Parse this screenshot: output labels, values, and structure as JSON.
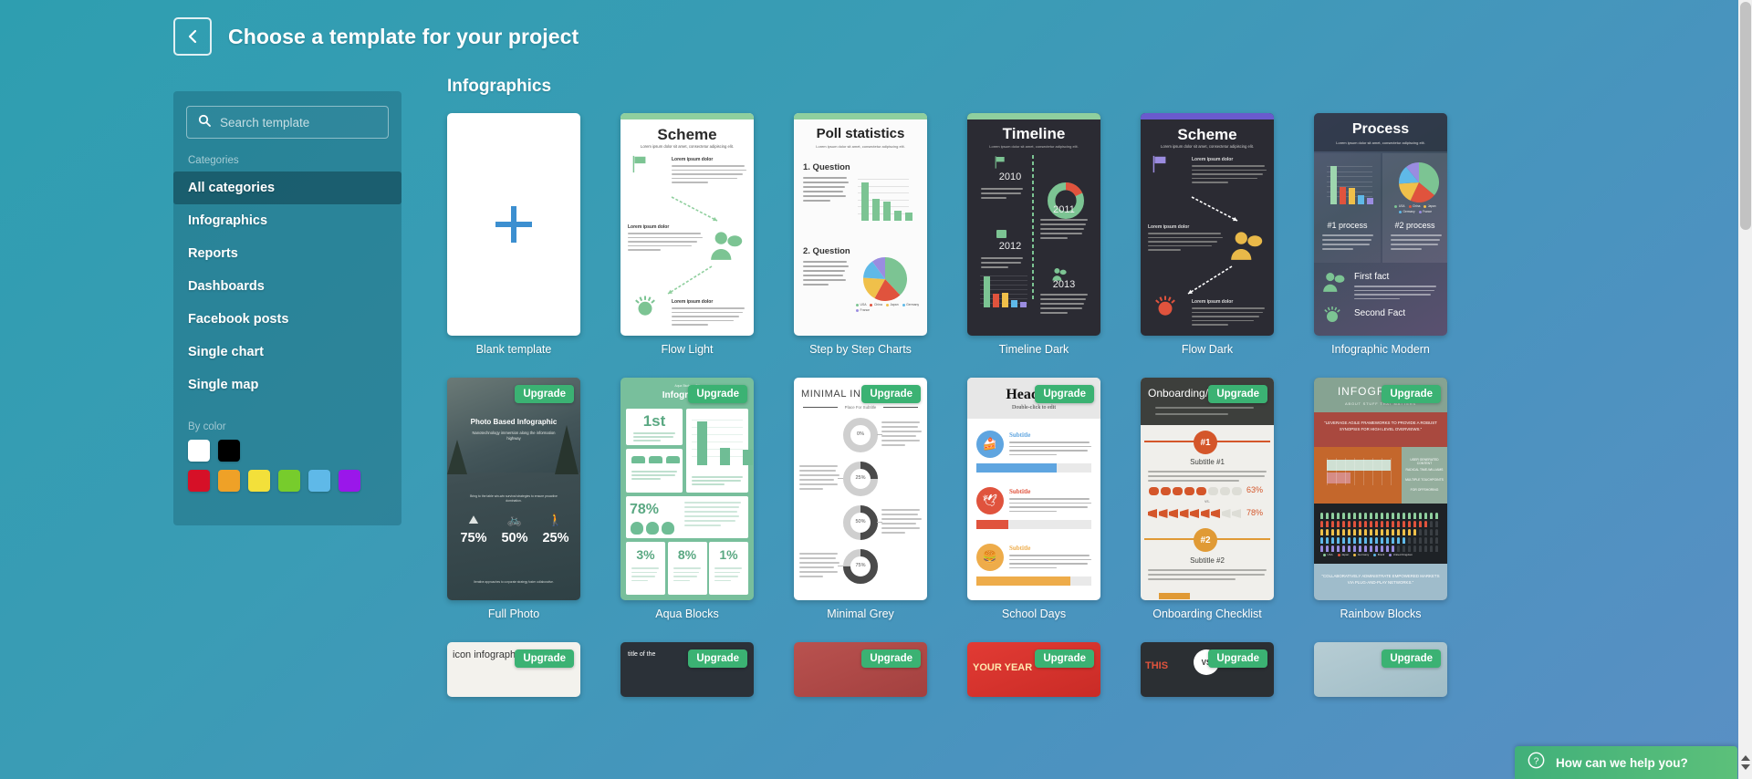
{
  "header": {
    "title": "Choose a template for your project",
    "back_icon": "chevron-left-icon"
  },
  "sidebar": {
    "search": {
      "placeholder": "Search template",
      "value": "",
      "icon": "search-icon"
    },
    "categories_heading": "Categories",
    "categories": [
      {
        "label": "All categories",
        "active": true
      },
      {
        "label": "Infographics",
        "active": false
      },
      {
        "label": "Reports",
        "active": false
      },
      {
        "label": "Dashboards",
        "active": false
      },
      {
        "label": "Facebook posts",
        "active": false
      },
      {
        "label": "Single chart",
        "active": false
      },
      {
        "label": "Single map",
        "active": false
      }
    ],
    "bycolor_heading": "By color",
    "colors": [
      [
        "#ffffff",
        "#000000"
      ],
      [
        "#d61027",
        "#efa127",
        "#f3e03a",
        "#77cc2c",
        "#5fb9e8",
        "#9a17ea"
      ]
    ]
  },
  "main": {
    "section_title": "Infographics",
    "rows": [
      {
        "cards": [
          {
            "label": "Blank template",
            "upgrade": false,
            "kind": "blank"
          },
          {
            "label": "Flow Light",
            "upgrade": false,
            "kind": "flow-light",
            "title": "Scheme",
            "subtitle": "Lorem ipsum dolor sit amet, consectetur adipiscing elit.",
            "blocks": [
              "Lorem ipsum dolor",
              "Lorem ipsum dolor",
              "Lorem ipsum dolor"
            ]
          },
          {
            "label": "Step by Step Charts",
            "upgrade": false,
            "kind": "poll",
            "title": "Poll statistics",
            "subtitle": "Lorem ipsum dolor sit amet, consectetur adipiscing elit.",
            "q1": "1. Question",
            "q2": "2. Question"
          },
          {
            "label": "Timeline Dark",
            "upgrade": false,
            "kind": "timeline-dark",
            "title": "Timeline",
            "subtitle": "Lorem ipsum dolor sit amet, consectetur adipiscing elit.",
            "years": [
              "2010",
              "2011",
              "2012",
              "2013"
            ]
          },
          {
            "label": "Flow Dark",
            "upgrade": false,
            "kind": "flow-dark",
            "title": "Scheme",
            "subtitle": "Lorem ipsum dolor sit amet, consectetur adipiscing elit.",
            "blocks": [
              "Lorem ipsum dolor",
              "Lorem ipsum dolor",
              "Lorem ipsum dolor"
            ]
          },
          {
            "label": "Infographic Modern",
            "upgrade": false,
            "kind": "modern",
            "title": "Process",
            "subtitle": "Lorem ipsum dolor sit amet, consectetur adipiscing elit.",
            "p1": "#1 process",
            "p2": "#2 process",
            "fact1": "First fact",
            "fact2": "Second Fact"
          }
        ]
      },
      {
        "cards": [
          {
            "label": "Full Photo",
            "upgrade": true,
            "kind": "full-photo",
            "title": "Photo Based Infographic",
            "subtitle": "Nanotechnology immersion along the information highway",
            "stats": [
              "75%",
              "50%",
              "25%"
            ]
          },
          {
            "label": "Aqua Blocks",
            "upgrade": true,
            "kind": "aqua",
            "title": "Infographic",
            "big": "1st",
            "stats": [
              "78%",
              "3%",
              "8%",
              "1%"
            ]
          },
          {
            "label": "Minimal Grey",
            "upgrade": true,
            "kind": "minimal-grey",
            "title": "MINIMAL INFO",
            "subtitle": "Place For Subtitle",
            "donuts": [
              "0%",
              "25%",
              "50%",
              "75%"
            ]
          },
          {
            "label": "School Days",
            "upgrade": true,
            "kind": "school",
            "title": "Headline",
            "subtitle": "Double-click to edit",
            "subtitles": [
              "Subtitle",
              "Subtitle",
              "Subtitle"
            ]
          },
          {
            "label": "Onboarding Checklist",
            "upgrade": true,
            "kind": "onboarding",
            "title": "Onboarding/Checklist",
            "badges": [
              "#1",
              "#2"
            ],
            "subtitles": [
              "Subtitle #1",
              "Subtitle #2"
            ],
            "vs": "vs.",
            "stats": [
              "63%",
              "78%"
            ]
          },
          {
            "label": "Rainbow Blocks",
            "upgrade": true,
            "kind": "rainbow",
            "title": "INFOGRAPHIC",
            "subtitle": "ABOUT STUFF THAT MATTERS",
            "quote1": "\"LEVERAGE AGILE FRAMEWORKS TO PROVIDE A ROBUST SYNOPSIS FOR HIGH LEVEL OVERVIEWS.\"",
            "quote2": "\"COLLABORATIVELY ADMINISTRATE EMPOWERED MARKETS VIA PLUG-AND-PLAY NETWORKS.\""
          }
        ]
      },
      {
        "cards": [
          {
            "label": "",
            "upgrade": true,
            "kind": "r3-icon",
            "title": "icon infographic"
          },
          {
            "label": "",
            "upgrade": true,
            "kind": "r3-dark",
            "title": "title of the"
          },
          {
            "label": "",
            "upgrade": true,
            "kind": "r3-red1",
            "title": ""
          },
          {
            "label": "",
            "upgrade": true,
            "kind": "r3-red2",
            "title": "YOUR YEAR"
          },
          {
            "label": "",
            "upgrade": true,
            "kind": "r3-vs",
            "title": "THIS",
            "vs": "VS"
          },
          {
            "label": "",
            "upgrade": true,
            "kind": "r3-pale",
            "title": ""
          }
        ]
      }
    ],
    "upgrade_label": "Upgrade"
  },
  "help": {
    "label": "How can we help you?",
    "icon": "question-circle-icon"
  },
  "colors": {
    "accent_green": "#3bb273",
    "background_teal": "#3a9cb5",
    "sidebar_bg": "rgba(17,77,92,0.30)"
  }
}
